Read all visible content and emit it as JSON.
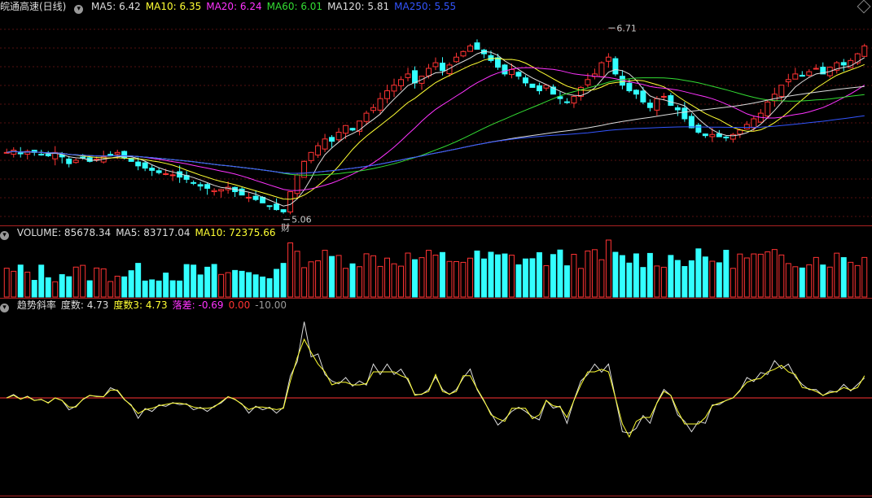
{
  "title": "皖通高速(日线)",
  "ma_legend": [
    {
      "label": "MA5: 6.42",
      "color": "#dddddd"
    },
    {
      "label": "MA10: 6.35",
      "color": "#ffff33"
    },
    {
      "label": "MA20: 6.24",
      "color": "#ff33ff"
    },
    {
      "label": "MA60: 6.01",
      "color": "#33dd33"
    },
    {
      "label": "MA120: 5.81",
      "color": "#dddddd"
    },
    {
      "label": "MA250: 5.55",
      "color": "#3355ff"
    }
  ],
  "volume_legend": [
    {
      "label": "VOLUME: 85678.34",
      "color": "#dddddd"
    },
    {
      "label": "MA5: 83717.04",
      "color": "#dddddd"
    },
    {
      "label": "MA10: 72375.66",
      "color": "#ffff33"
    }
  ],
  "indicator_legend": [
    {
      "label": "趋势斜率",
      "color": "#dddddd"
    },
    {
      "label": "度数: 4.73",
      "color": "#dddddd"
    },
    {
      "label": "度数3: 4.73",
      "color": "#ffff33"
    },
    {
      "label": "落差: -0.69",
      "color": "#ff33ff"
    },
    {
      "label": "0.00",
      "color": "#ff3333"
    },
    {
      "label": "-10.00",
      "color": "#999999"
    }
  ],
  "annotations": {
    "high": "6.71",
    "low": "5.06",
    "mark": "财"
  },
  "chart_data": {
    "type": "candlestick",
    "closes": [
      5.6,
      5.62,
      5.59,
      5.61,
      5.6,
      5.58,
      5.57,
      5.6,
      5.56,
      5.5,
      5.53,
      5.55,
      5.52,
      5.54,
      5.56,
      5.58,
      5.6,
      5.55,
      5.52,
      5.48,
      5.46,
      5.44,
      5.42,
      5.41,
      5.4,
      5.38,
      5.36,
      5.33,
      5.3,
      5.28,
      5.26,
      5.27,
      5.29,
      5.25,
      5.22,
      5.2,
      5.18,
      5.15,
      5.12,
      5.09,
      5.07,
      5.25,
      5.4,
      5.52,
      5.6,
      5.66,
      5.72,
      5.7,
      5.78,
      5.84,
      5.8,
      5.88,
      5.95,
      6.0,
      6.08,
      6.15,
      6.2,
      6.25,
      6.3,
      6.22,
      6.28,
      6.35,
      6.4,
      6.33,
      6.38,
      6.45,
      6.5,
      6.55,
      6.52,
      6.48,
      6.42,
      6.36,
      6.3,
      6.34,
      6.28,
      6.22,
      6.18,
      6.15,
      6.2,
      6.12,
      6.08,
      6.05,
      6.1,
      6.18,
      6.25,
      6.3,
      6.4,
      6.45,
      6.3,
      6.2,
      6.15,
      6.12,
      6.05,
      6.0,
      6.08,
      6.1,
      6.02,
      5.98,
      5.9,
      5.82,
      5.78,
      5.75,
      5.76,
      5.74,
      5.73,
      5.76,
      5.8,
      5.85,
      5.9,
      5.95,
      6.05,
      6.12,
      6.2,
      6.25,
      6.3,
      6.28,
      6.32,
      6.35,
      6.3,
      6.36,
      6.4,
      6.38,
      6.42,
      6.48,
      6.55
    ],
    "volume_ma5": 83717.04,
    "volume_ma10": 72375.66,
    "volume": 85678.34
  }
}
